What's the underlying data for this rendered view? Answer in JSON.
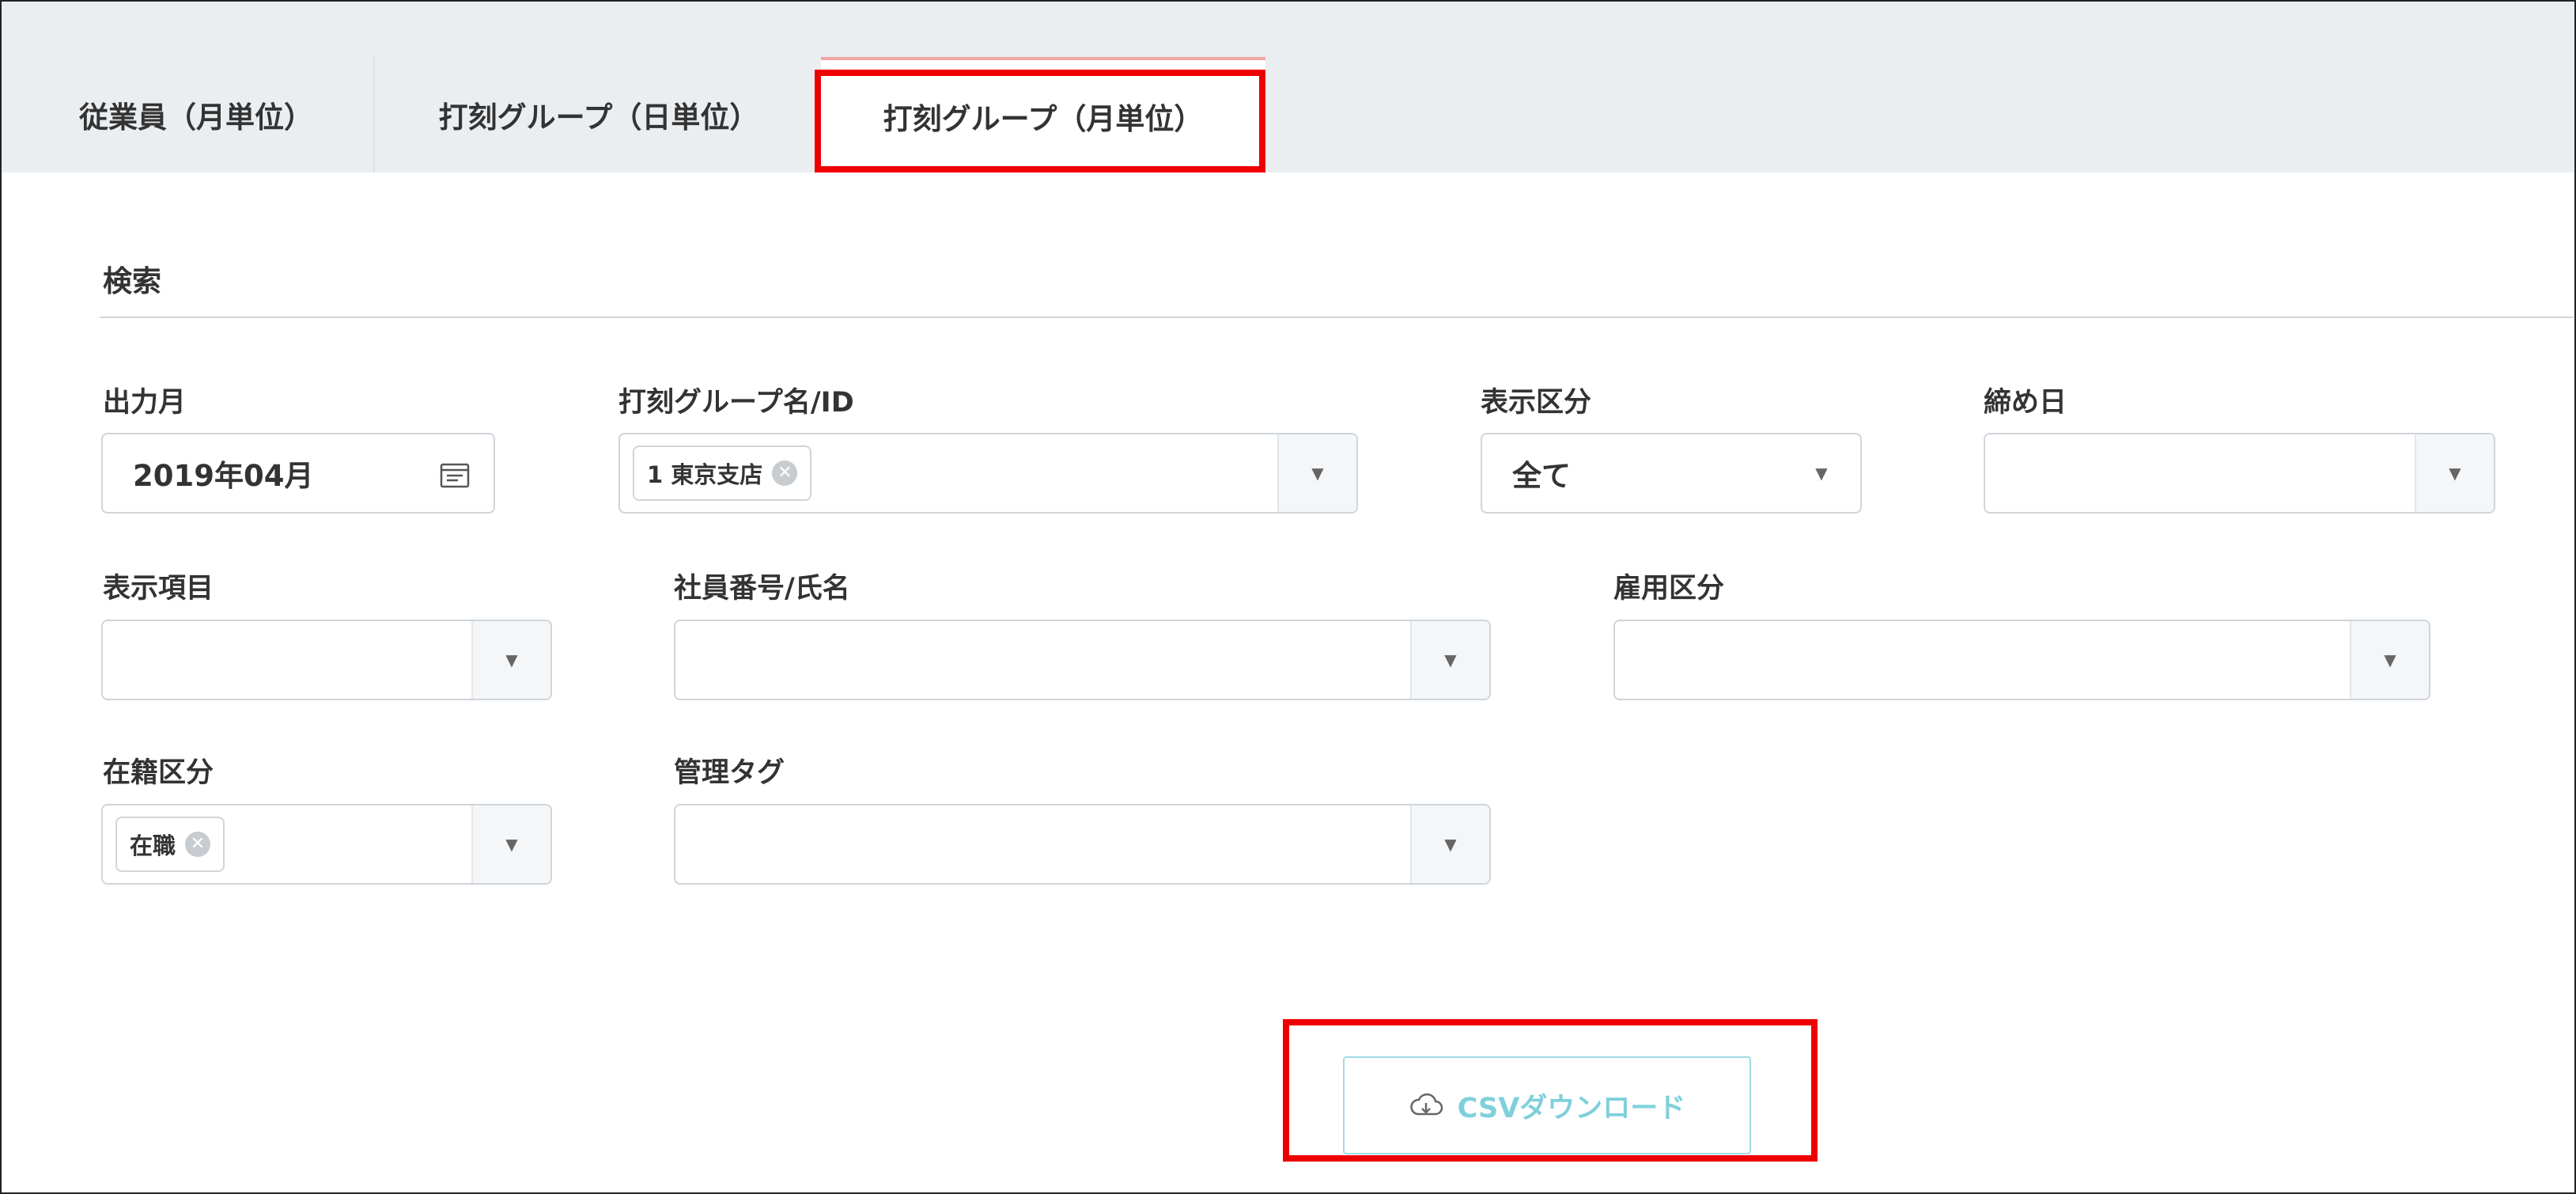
{
  "tabs": [
    {
      "label": "従業員（月単位）",
      "active": false
    },
    {
      "label": "打刻グループ（日単位）",
      "active": false
    },
    {
      "label": "打刻グループ（月単位）",
      "active": true
    }
  ],
  "search": {
    "title": "検索",
    "output_month": {
      "label": "出力月",
      "value": "2019年04月",
      "icon": "calendar-icon"
    },
    "group": {
      "label": "打刻グループ名/ID",
      "chip": "1 東京支店"
    },
    "display_type": {
      "label": "表示区分",
      "value": "全て"
    },
    "closing_day": {
      "label": "締め日",
      "value": ""
    },
    "display_items": {
      "label": "表示項目",
      "value": ""
    },
    "employee": {
      "label": "社員番号/氏名",
      "value": ""
    },
    "employment_type": {
      "label": "雇用区分",
      "value": ""
    },
    "enrollment": {
      "label": "在籍区分",
      "chip": "在職"
    },
    "tag": {
      "label": "管理タグ",
      "value": ""
    }
  },
  "csv_button": {
    "label": "CSVダウンロード",
    "icon": "cloud-download-icon"
  },
  "colors": {
    "highlight": "#ee0000",
    "accent": "#7fd0dc",
    "tab_bg": "#ebeef1"
  }
}
